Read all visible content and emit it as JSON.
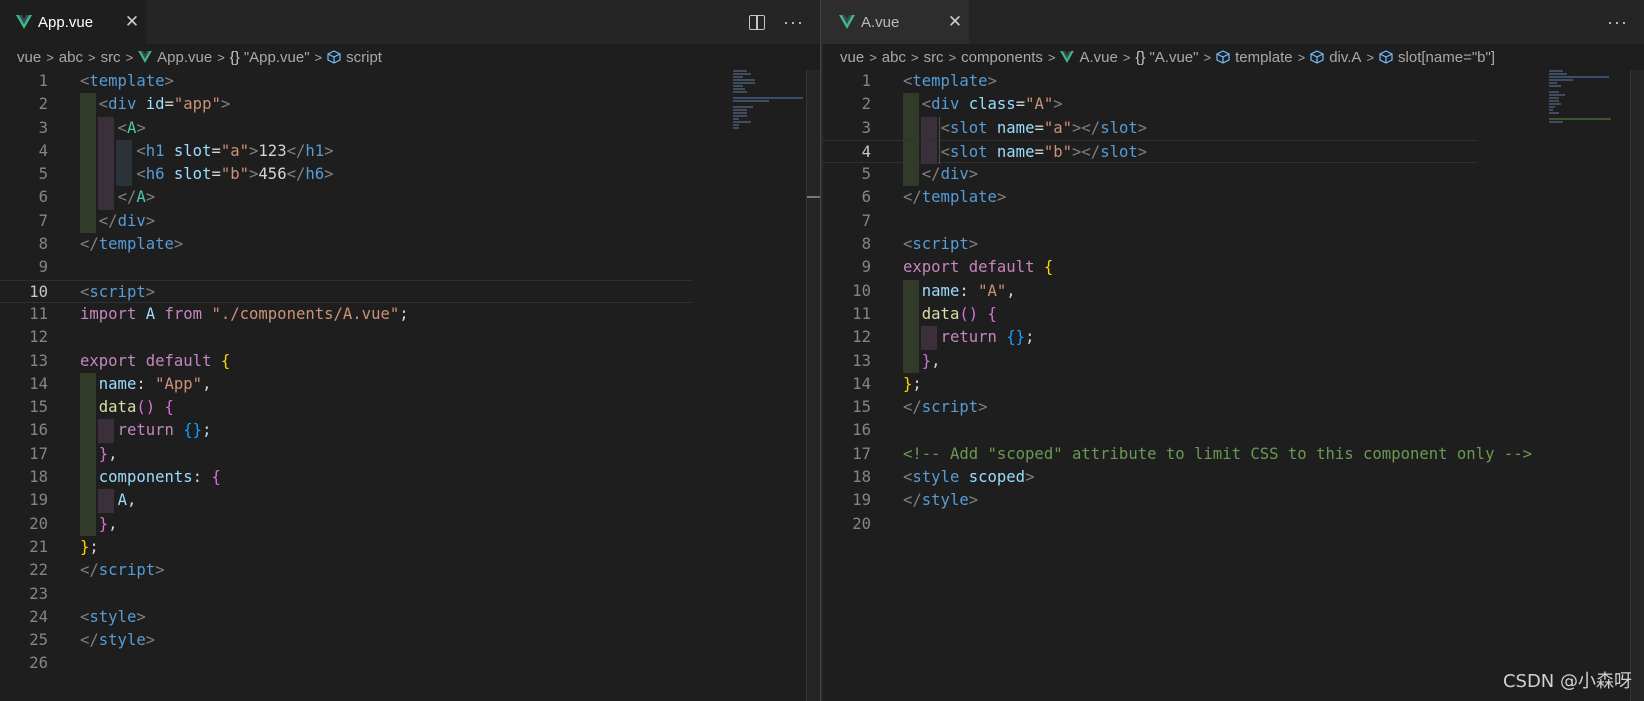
{
  "left": {
    "tab": {
      "label": "App.vue",
      "close": "✕"
    },
    "actions": {
      "more": "···"
    },
    "breadcrumb": [
      "vue",
      "abc",
      "src",
      "App.vue",
      "\"App.vue\"",
      "script"
    ],
    "lines": [
      "1",
      "2",
      "3",
      "4",
      "5",
      "6",
      "7",
      "8",
      "9",
      "10",
      "11",
      "12",
      "13",
      "14",
      "15",
      "16",
      "17",
      "18",
      "19",
      "20",
      "21",
      "22",
      "23",
      "24",
      "25",
      "26"
    ]
  },
  "right": {
    "tab": {
      "label": "A.vue",
      "close": "✕"
    },
    "actions": {
      "more": "···"
    },
    "breadcrumb": [
      "vue",
      "abc",
      "src",
      "components",
      "A.vue",
      "\"A.vue\"",
      "template",
      "div.A",
      "slot[name=\"b\"]"
    ],
    "lines": [
      "1",
      "2",
      "3",
      "4",
      "5",
      "6",
      "7",
      "8",
      "9",
      "10",
      "11",
      "12",
      "13",
      "14",
      "15",
      "16",
      "17",
      "18",
      "19",
      "20"
    ]
  },
  "watermark": "CSDN @小森呀",
  "colors": {
    "tag": "#569cd6",
    "attr": "#9cdcfe",
    "string": "#ce9178",
    "keyword": "#c586c0",
    "comment": "#6a9955"
  }
}
